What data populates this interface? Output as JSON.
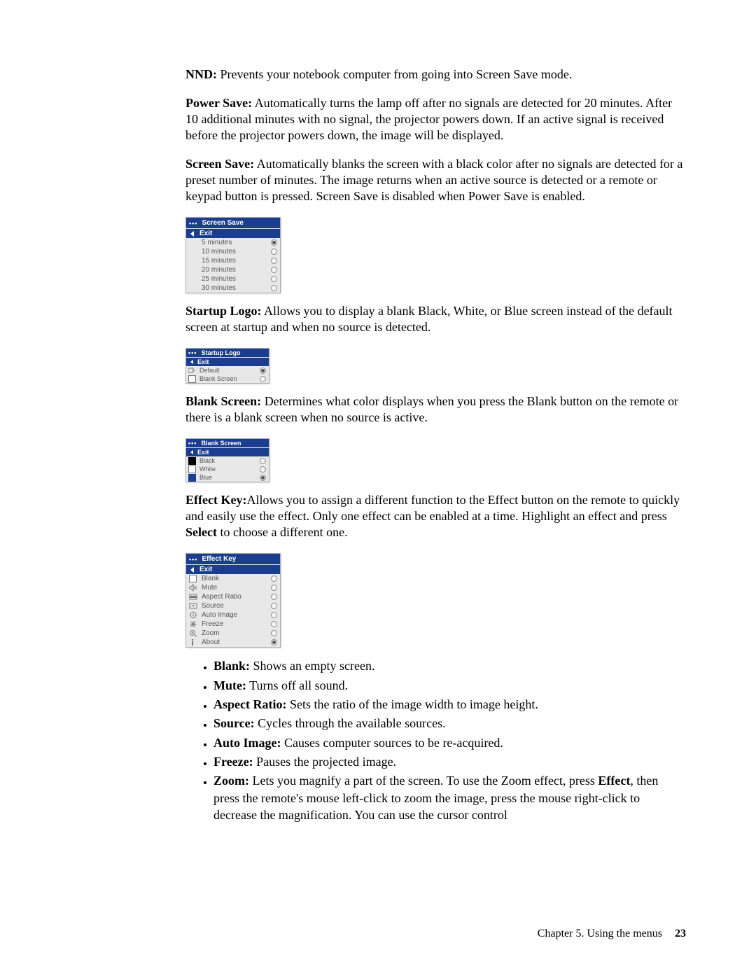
{
  "paragraphs": {
    "nnd_label": "NND:",
    "nnd": " Prevents your notebook computer from going into Screen Save mode.",
    "power_save_label": "Power Save:",
    "power_save": " Automatically turns the lamp off after no signals are detected for 20 minutes. After 10 additional minutes with no signal, the projector powers down. If an active signal is received before the projector powers down, the image will be displayed.",
    "screen_save_label": "Screen Save:",
    "screen_save": " Automatically blanks the screen with a black color after no signals are detected for a preset number of minutes. The image returns when an active source is detected or a remote or keypad button is pressed. Screen Save is disabled when Power Save is enabled.",
    "startup_logo_label": "Startup Logo:",
    "startup_logo": " Allows you to display a blank Black, White, or Blue screen instead of the default screen at startup and when no source is detected.",
    "blank_screen_label": "Blank Screen:",
    "blank_screen": " Determines what color displays when you press the Blank button on the remote or there is a blank screen when no source is active.",
    "effect_key_label": "Effect Key:",
    "effect_key_a": "Allows you to assign a different function to the Effect button on the remote to quickly and easily use the effect. Only one effect can be enabled at a time. Highlight an effect and press ",
    "effect_key_select": "Select",
    "effect_key_b": " to choose a different one."
  },
  "menus": {
    "exit": "Exit",
    "screen_save": {
      "title": "Screen Save",
      "items": [
        {
          "label": "5 minutes",
          "selected": true
        },
        {
          "label": "10 minutes",
          "selected": false
        },
        {
          "label": "15 minutes",
          "selected": false
        },
        {
          "label": "20 minutes",
          "selected": false
        },
        {
          "label": "25 minutes",
          "selected": false
        },
        {
          "label": "30 minutes",
          "selected": false
        }
      ]
    },
    "startup_logo": {
      "title": "Startup Logo",
      "items": [
        {
          "label": "Default",
          "selected": true
        },
        {
          "label": "Blank Screen",
          "selected": false
        }
      ]
    },
    "blank_screen": {
      "title": "Blank Screen",
      "items": [
        {
          "label": "Black",
          "selected": false
        },
        {
          "label": "White",
          "selected": false
        },
        {
          "label": "Blue",
          "selected": true
        }
      ]
    },
    "effect_key": {
      "title": "Effect Key",
      "items": [
        {
          "label": "Blank",
          "selected": false
        },
        {
          "label": "Mute",
          "selected": false
        },
        {
          "label": "Aspect Ratio",
          "selected": false
        },
        {
          "label": "Source",
          "selected": false
        },
        {
          "label": "Auto Image",
          "selected": false
        },
        {
          "label": "Freeze",
          "selected": false
        },
        {
          "label": "Zoom",
          "selected": false
        },
        {
          "label": "About",
          "selected": true
        }
      ]
    }
  },
  "bullets": {
    "blank_l": "Blank:",
    "blank": " Shows an empty screen.",
    "mute_l": "Mute:",
    "mute": " Turns off all sound.",
    "aspect_l": "Aspect Ratio:",
    "aspect": " Sets the ratio of the image width to image height.",
    "source_l": "Source:",
    "source": " Cycles through the available sources.",
    "auto_l": "Auto Image:",
    "auto": " Causes computer sources to be re-acquired.",
    "freeze_l": "Freeze:",
    "freeze": " Pauses the projected image.",
    "zoom_l": "Zoom:",
    "zoom_a": " Lets you magnify a part of the screen. To use the Zoom effect, press ",
    "zoom_effect": "Effect",
    "zoom_b": ", then press the remote's mouse left-click to zoom the image, press the mouse right-click to decrease the magnification. You can use the cursor control"
  },
  "footer": {
    "chapter": "Chapter 5. Using the menus",
    "page": "23"
  }
}
